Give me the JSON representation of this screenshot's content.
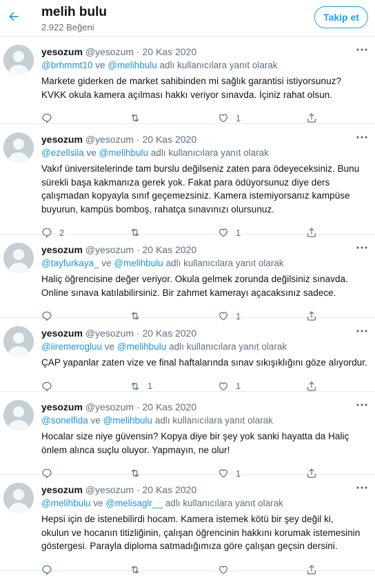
{
  "header": {
    "title": "melih bulu",
    "subtitle": "2.922 Beğeni",
    "follow_label": "Takip et"
  },
  "colors": {
    "accent": "#1da1f2",
    "link": "#1b95e0",
    "muted": "#5b7083"
  },
  "replying_suffix": "adlı kullanıcılara yanıt olarak",
  "tweets": [
    {
      "name": "yesozum",
      "handle": "@yesozum",
      "date": "20 Kas 2020",
      "mention1": "@brhmmt10",
      "conj": "ve",
      "mention2": "@melihbulu",
      "lines": [
        "Markete giderken de market sahibinden mi sağlık garantisi istiyorsunuz?",
        "KVKK okula kamera açılması hakkı veriyor sınavda. İçiniz rahat olsun."
      ],
      "replies": "",
      "retweets": "",
      "likes": "1"
    },
    {
      "name": "yesozum",
      "handle": "@yesozum",
      "date": "20 Kas 2020",
      "mention1": "@ezellsila",
      "conj": "ve",
      "mention2": "@melihbulu",
      "lines": [
        "Vakıf üniversitelerinde tam burslu değilseniz zaten para ödeyeceksiniz. Bunu",
        "sürekli başa kakmanıza gerek yok. Fakat para ödüyorsunuz diye ders",
        "çalışmadan kopyayla sınıf geçemezsiniz. Kamera istemiyorsanız kampüse",
        "buyurun, kampüs bomboş, rahatça sınavınızı olursunuz."
      ],
      "replies": "2",
      "retweets": "",
      "likes": "1"
    },
    {
      "name": "yesozum",
      "handle": "@yesozum",
      "date": "20 Kas 2020",
      "mention1": "@tayfurkaya_",
      "conj": "ve",
      "mention2": "@melihbulu",
      "lines": [
        "Haliç öğrencisine değer veriyor. Okula gelmek zorunda değilsiniz sınavda.",
        "Online sınava katılabilirsiniz. Bir zahmet kamerayı açacaksınız sadece."
      ],
      "replies": "",
      "retweets": "",
      "likes": "1"
    },
    {
      "name": "yesozum",
      "handle": "@yesozum",
      "date": "20 Kas 2020",
      "mention1": "@iiremerogluu",
      "conj": "ve",
      "mention2": "@melihbulu",
      "lines": [
        "ÇAP yapanlar zaten vize ve final haftalarında sınav sıkışıklığını göze alıyordur."
      ],
      "replies": "",
      "retweets": "1",
      "likes": "1"
    },
    {
      "name": "yesozum",
      "handle": "@yesozum",
      "date": "20 Kas 2020",
      "mention1": "@sonelfida",
      "conj": "ve",
      "mention2": "@melihbulu",
      "lines": [
        "Hocalar size niye güvensin? Kopya diye bir şey yok sanki hayatta da Haliç",
        "önlem alınca suçlu oluyor. Yapmayın, ne olur!"
      ],
      "replies": "",
      "retweets": "",
      "likes": "1"
    },
    {
      "name": "yesozum",
      "handle": "@yesozum",
      "date": "20 Kas 2020",
      "mention1": "@melihbulu",
      "conj": "ve",
      "mention2": "@melisaglr__",
      "lines": [
        "Hepsi için de istenebilirdi hocam. Kamera istemek kötü bir şey değil ki,",
        "okulun ve hocanın titizliğinin, çalışan öğrencinin hakkını korumak istemesinin",
        "göstergesi. Parayla diploma satmadığımıza göre çalışan geçsin dersini."
      ],
      "replies": "",
      "retweets": "",
      "likes": ""
    }
  ]
}
